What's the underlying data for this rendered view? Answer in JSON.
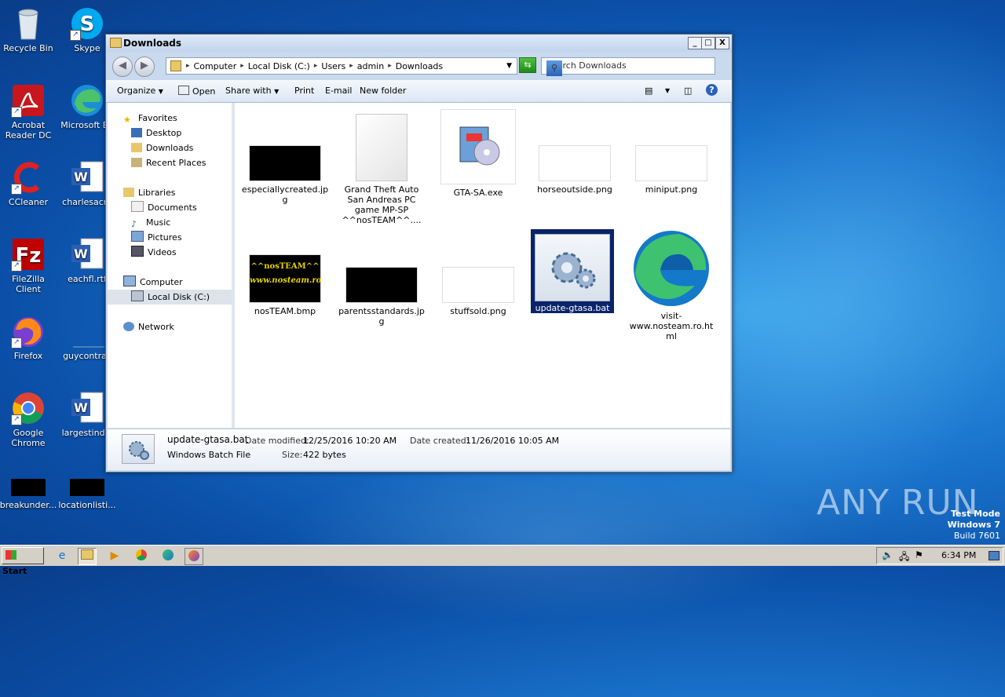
{
  "desktop": {
    "icons": [
      {
        "label": "Recycle Bin"
      },
      {
        "label": "Skype"
      },
      {
        "label": "Acrobat\nReader DC"
      },
      {
        "label": "Microsoft Ed"
      },
      {
        "label": "CCleaner"
      },
      {
        "label": "charlesacro"
      },
      {
        "label": "FileZilla Client"
      },
      {
        "label": "eachfl.rtf"
      },
      {
        "label": "Firefox"
      },
      {
        "label": "guycontrac"
      },
      {
        "label": "Google\nChrome"
      },
      {
        "label": "largestindia"
      },
      {
        "label": "breakunder..."
      },
      {
        "label": "locationlisti..."
      }
    ],
    "watermark": "ANY RUN",
    "test_mode": {
      "line1": "Test Mode",
      "line2": "Windows 7",
      "line3": "Build 7601"
    }
  },
  "window": {
    "title": "Downloads",
    "buttons": {
      "minimize": "_",
      "maximize": "□",
      "close": "X"
    },
    "breadcrumb": [
      "Computer",
      "Local Disk (C:)",
      "Users",
      "admin",
      "Downloads"
    ],
    "search_placeholder": "Search Downloads",
    "toolbar": {
      "organize": "Organize",
      "open": "Open",
      "share_with": "Share with",
      "print": "Print",
      "email": "E-mail",
      "new_folder": "New folder"
    },
    "nav": {
      "favorites": "Favorites",
      "desktop": "Desktop",
      "downloads": "Downloads",
      "recent_places": "Recent Places",
      "libraries": "Libraries",
      "documents": "Documents",
      "music": "Music",
      "pictures": "Pictures",
      "videos": "Videos",
      "computer": "Computer",
      "local_disk": "Local Disk (C:)",
      "network": "Network"
    },
    "files": [
      {
        "name": "especiallycreated.jpg"
      },
      {
        "name": "Grand Theft Auto San Andreas PC game MP-SP ^^nosTEAM^^...."
      },
      {
        "name": "GTA-SA.exe"
      },
      {
        "name": "horseoutside.png"
      },
      {
        "name": "miniput.png"
      },
      {
        "name": "nosTEAM.bmp",
        "thumb_text1": "^^nosTEAM^^",
        "thumb_text2": "www.nosteam.ro"
      },
      {
        "name": "parentsstandards.jpg"
      },
      {
        "name": "stuffsold.png"
      },
      {
        "name": "update-gtasa.bat"
      },
      {
        "name": "visit-www.nosteam.ro.html"
      }
    ],
    "details": {
      "name": "update-gtasa.bat",
      "type": "Windows Batch File",
      "modified_label": "Date modified:",
      "modified": "12/25/2016 10:20 AM",
      "created_label": "Date created:",
      "created": "11/26/2016 10:05 AM",
      "size_label": "Size:",
      "size": "422 bytes"
    }
  },
  "taskbar": {
    "start": "Start",
    "clock": "6:34 PM"
  }
}
